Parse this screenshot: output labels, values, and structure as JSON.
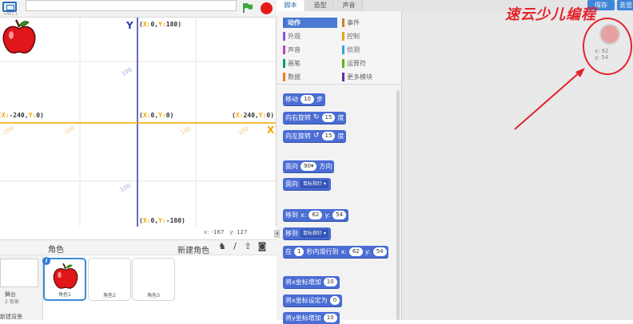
{
  "toolbar": {
    "version": "v461.1",
    "project_title": ""
  },
  "stage": {
    "coords": {
      "top": {
        "x": "0",
        "y": "180"
      },
      "center": {
        "x": "0",
        "y": "0"
      },
      "left": {
        "x": "-240",
        "y": "0"
      },
      "right": {
        "x": "240",
        "y": "0"
      },
      "bottom": {
        "x": "0",
        "y": "-180"
      }
    },
    "axis_x": "X",
    "axis_y": "Y",
    "ticks_x": [
      "-200",
      "-100",
      "100",
      "200"
    ],
    "ticks_y": [
      "100",
      "-100"
    ]
  },
  "mouse": {
    "x_label": "x:",
    "x": "-167",
    "y_label": "y:",
    "y": "127"
  },
  "sprite_pane": {
    "title": "角色",
    "new_sprite": "新建角色",
    "stage_label": "舞台",
    "stage_sub": "2 背景",
    "new_backdrop": "新建背景",
    "sprites": [
      "角色1",
      "角色2",
      "角色3"
    ]
  },
  "tabs": [
    "脚本",
    "造型",
    "声音"
  ],
  "buttons": {
    "save": "保存",
    "cloud": "去览"
  },
  "categories": [
    {
      "label": "动作",
      "color": "#4a6cd4"
    },
    {
      "label": "事件",
      "color": "#c88330"
    },
    {
      "label": "外观",
      "color": "#8a55d7"
    },
    {
      "label": "控制",
      "color": "#e1a91a"
    },
    {
      "label": "声音",
      "color": "#bb42c3"
    },
    {
      "label": "侦测",
      "color": "#2ca5e2"
    },
    {
      "label": "画笔",
      "color": "#0e9a6c"
    },
    {
      "label": "运算符",
      "color": "#5cb712"
    },
    {
      "label": "数据",
      "color": "#ee7d16"
    },
    {
      "label": "更多模块",
      "color": "#632d99"
    }
  ],
  "blocks": {
    "move": {
      "label": "移动",
      "value": "10",
      "unit": "步"
    },
    "turn_right": {
      "label": "向右旋转",
      "value": "15",
      "unit": "度"
    },
    "turn_left": {
      "label": "向左旋转",
      "value": "15",
      "unit": "度"
    },
    "point_dir": {
      "label": "面向",
      "value": "90▾",
      "unit": "方向"
    },
    "point_towards": {
      "label": "面向",
      "value": "鼠标指针 ▾"
    },
    "goto_xy": {
      "label": "移到",
      "x_label": "x:",
      "x": "62",
      "y_label": "y:",
      "y": "54"
    },
    "goto": {
      "label": "移到",
      "value": "鼠标指针 ▾"
    },
    "glide": {
      "label": "在",
      "secs": "1",
      "mid": "秒内滑行到",
      "x_label": "x:",
      "x": "62",
      "y_label": "y:",
      "y": "54"
    },
    "change_x": {
      "label": "将x坐标增加",
      "value": "10"
    },
    "set_x": {
      "label": "将x坐标设定为",
      "value": "0"
    },
    "change_y": {
      "label": "将y坐标增加",
      "value": "10"
    }
  },
  "script_area": {
    "sprite_x": "x: 62",
    "sprite_y": "y: 54"
  },
  "watermark": "速云少儿编程",
  "colors": {
    "accent": "#4a6cd4",
    "annotation": "#e2232a",
    "axis_x": "#f0a500",
    "axis_y": "#2f3aa8"
  }
}
